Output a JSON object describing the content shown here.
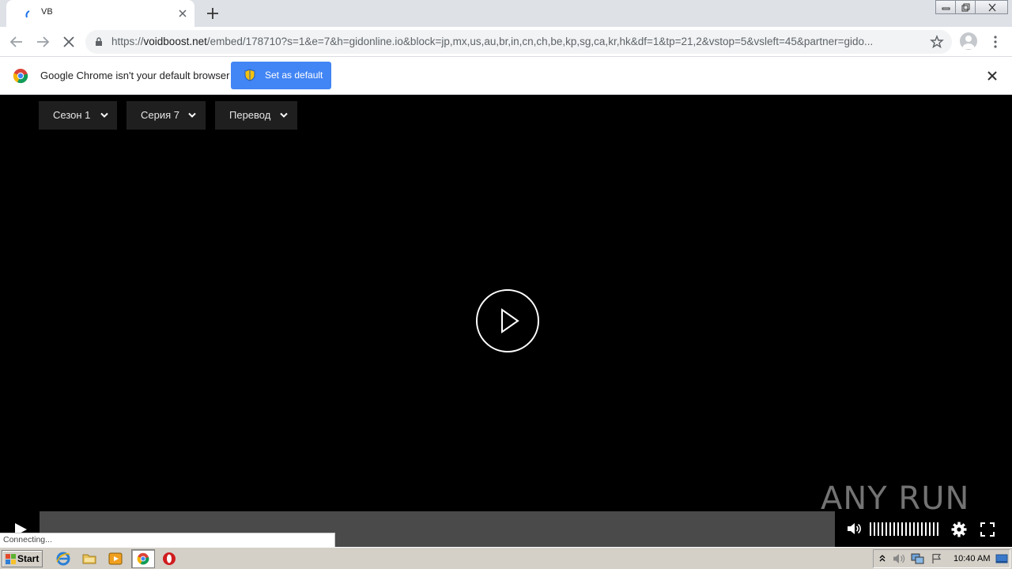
{
  "browser": {
    "tab": {
      "title": "VB"
    },
    "url": {
      "scheme": "https://",
      "host": "voidboost.net",
      "path": "/embed/178710?s=1&e=7&h=gidonline.io&block=jp,mx,us,au,br,in,cn,ch,be,kp,sg,ca,kr,hk&df=1&tp=21,2&vstop=5&vsleft=45&partner=gido..."
    },
    "infobar": {
      "message": "Google Chrome isn't your default browser",
      "button_label": "Set as default"
    },
    "status": "Connecting..."
  },
  "player": {
    "dropdowns": [
      {
        "label": "Сезон 1"
      },
      {
        "label": "Серия 7"
      },
      {
        "label": "Перевод"
      }
    ],
    "watermark": "ANY RUN"
  },
  "taskbar": {
    "start_label": "Start",
    "clock": "10:40 AM",
    "pinned": [
      "ie-icon",
      "folder-icon",
      "media-player-icon",
      "chrome-icon",
      "opera-icon"
    ]
  },
  "colors": {
    "accent": "#4285f4",
    "tab_strip": "#dee1e6",
    "player_bg": "#000000",
    "dropdown_bg": "#1f1f1f",
    "taskbar": "#d4d0c8"
  }
}
